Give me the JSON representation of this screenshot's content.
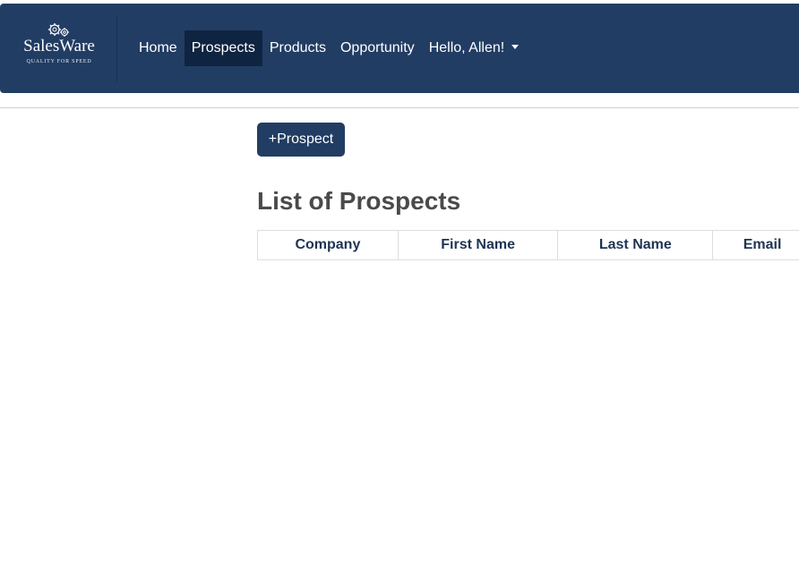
{
  "brand": {
    "name": "SalesWare",
    "tagline": "QUALITY FOR SPEED",
    "icon": "gears-icon"
  },
  "nav": {
    "items": [
      {
        "label": "Home",
        "active": false
      },
      {
        "label": "Prospects",
        "active": true
      },
      {
        "label": "Products",
        "active": false
      },
      {
        "label": "Opportunity",
        "active": false
      }
    ],
    "user_menu": {
      "label": "Hello, Allen!",
      "icon": "caret-down-icon"
    }
  },
  "actions": {
    "add_prospect_label": "+Prospect"
  },
  "main": {
    "title": "List of Prospects",
    "table": {
      "columns": [
        "Company",
        "First Name",
        "Last Name",
        "Email"
      ],
      "rows": []
    }
  },
  "colors": {
    "navbar": "#223d63",
    "nav_active": "#0f2440",
    "button": "#223d63",
    "title": "#4a4a4a",
    "header_text": "#1f3452"
  }
}
